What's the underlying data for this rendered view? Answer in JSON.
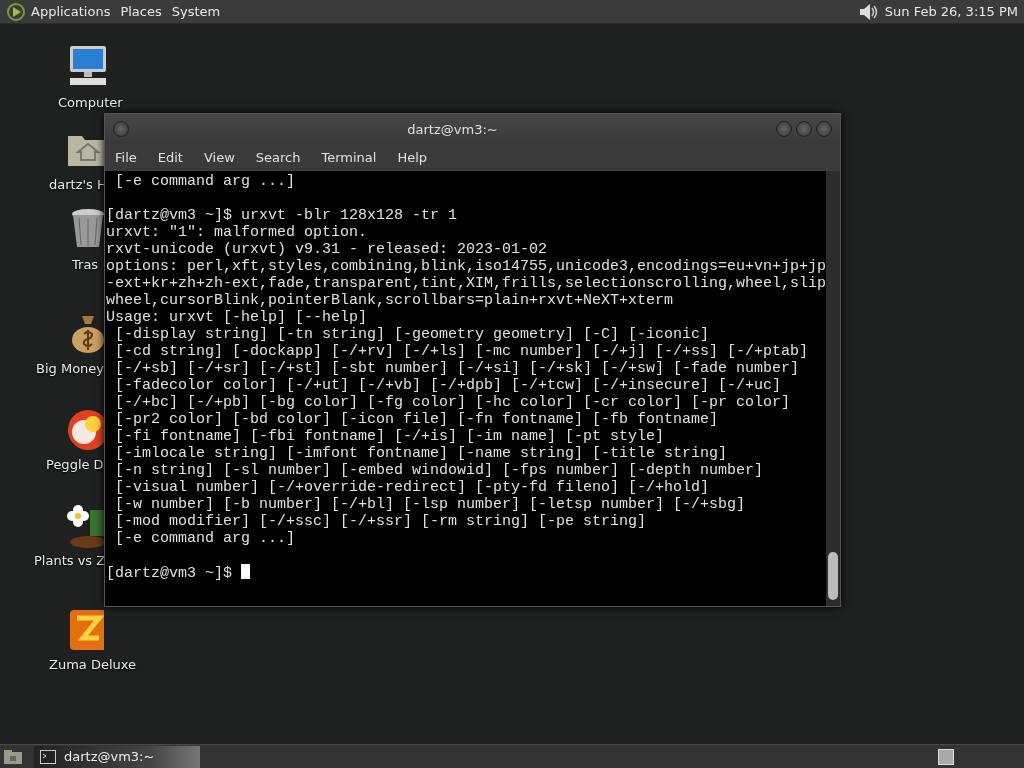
{
  "top_panel": {
    "menus": [
      "Applications",
      "Places",
      "System"
    ],
    "clock": "Sun Feb 26,  3:15 PM"
  },
  "desktop_icons": [
    {
      "label": "Computer",
      "kind": "computer"
    },
    {
      "label": "dartz's H",
      "kind": "home"
    },
    {
      "label": "Tras",
      "kind": "trash"
    },
    {
      "label": "Big Money",
      "kind": "money"
    },
    {
      "label": "Peggle D",
      "kind": "peggle"
    },
    {
      "label": "Plants vs Z",
      "kind": "plants"
    },
    {
      "label": "Zuma Deluxe",
      "kind": "zuma"
    }
  ],
  "terminal": {
    "title": "dartz@vm3:~",
    "menu": [
      "File",
      "Edit",
      "View",
      "Search",
      "Terminal",
      "Help"
    ],
    "blocks": [
      [
        " [-e command arg ...]"
      ],
      [
        "[dartz@vm3 ~]$ urxvt -blr 128x128 -tr 1",
        "urxvt: \"1\": malformed option.",
        "rxvt-unicode (urxvt) v9.31 - released: 2023-01-02",
        "options: perl,xft,styles,combining,blink,iso14755,unicode3,encodings=eu+vn+jp+jp",
        "-ext+kr+zh+zh-ext,fade,transparent,tint,XIM,frills,selectionscrolling,wheel,slip",
        "wheel,cursorBlink,pointerBlank,scrollbars=plain+rxvt+NeXT+xterm",
        "Usage: urxvt [-help] [--help]",
        " [-display string] [-tn string] [-geometry geometry] [-C] [-iconic]",
        " [-cd string] [-dockapp] [-/+rv] [-/+ls] [-mc number] [-/+j] [-/+ss] [-/+ptab]",
        " [-/+sb] [-/+sr] [-/+st] [-sbt number] [-/+si] [-/+sk] [-/+sw] [-fade number]",
        " [-fadecolor color] [-/+ut] [-/+vb] [-/+dpb] [-/+tcw] [-/+insecure] [-/+uc]",
        " [-/+bc] [-/+pb] [-bg color] [-fg color] [-hc color] [-cr color] [-pr color]",
        " [-pr2 color] [-bd color] [-icon file] [-fn fontname] [-fb fontname]",
        " [-fi fontname] [-fbi fontname] [-/+is] [-im name] [-pt style]",
        " [-imlocale string] [-imfont fontname] [-name string] [-title string]",
        " [-n string] [-sl number] [-embed windowid] [-fps number] [-depth number]",
        " [-visual number] [-/+override-redirect] [-pty-fd fileno] [-/+hold]",
        " [-w number] [-b number] [-/+bl] [-lsp number] [-letsp number] [-/+sbg]",
        " [-mod modifier] [-/+ssc] [-/+ssr] [-rm string] [-pe string]",
        " [-e command arg ...]"
      ]
    ],
    "prompt": "[dartz@vm3 ~]$ "
  },
  "taskbar": {
    "tasks": [
      {
        "label": "dartz@vm3:~",
        "selected": true
      }
    ]
  }
}
